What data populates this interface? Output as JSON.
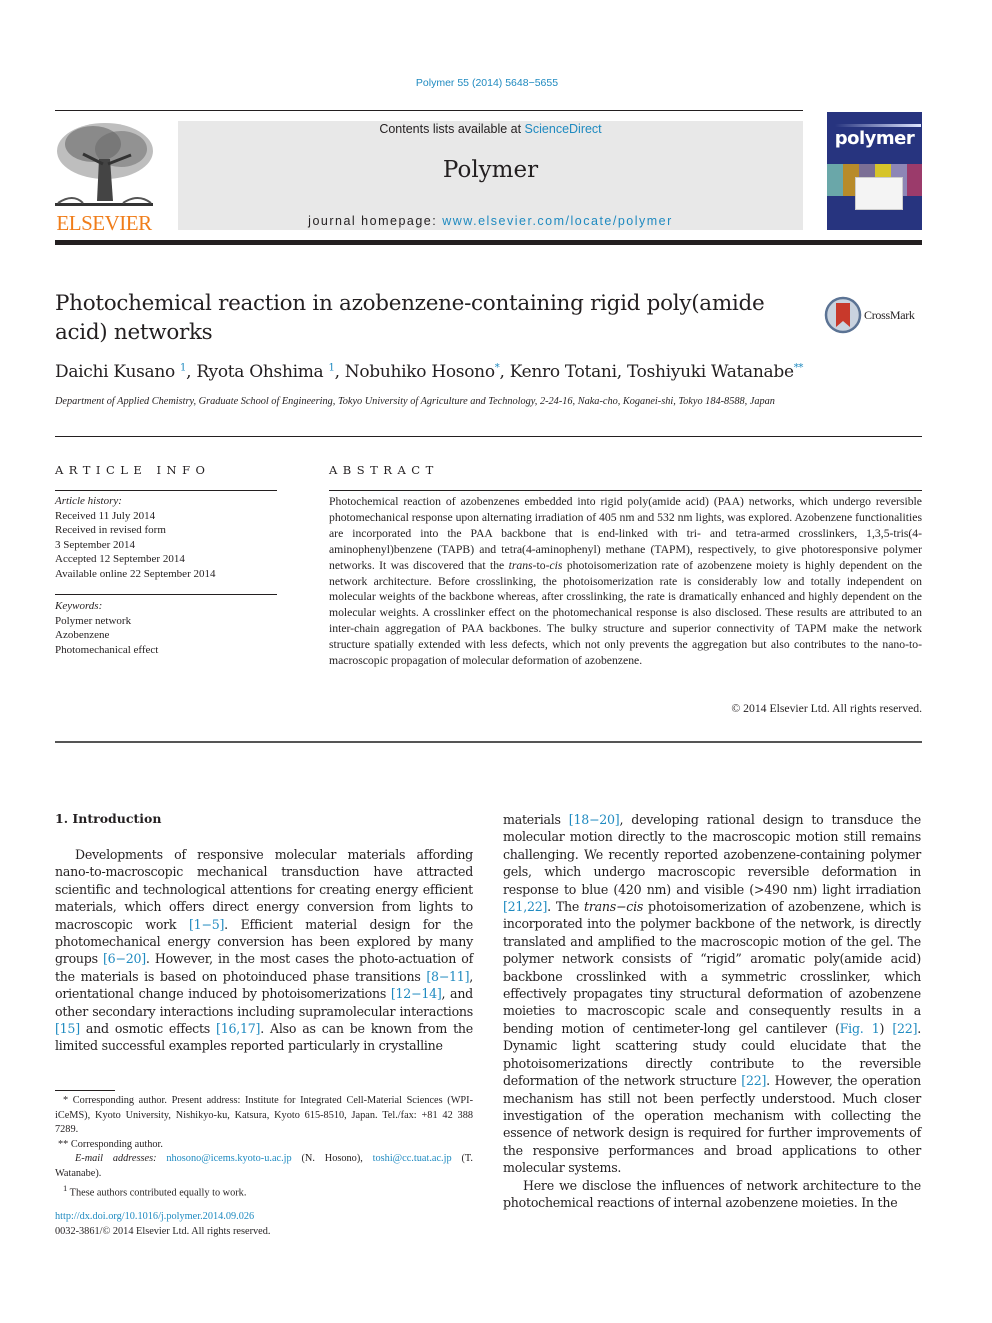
{
  "header": {
    "citation": "Polymer 55 (2014) 5648−5655",
    "contents_prefix": "Contents lists available at ",
    "contents_link": "ScienceDirect",
    "journal_title": "Polymer",
    "homepage_prefix": "journal homepage: ",
    "homepage_link": "www.elsevier.com/locate/polymer",
    "publisher_logo_text": "ELSEVIER",
    "cover_title": "polymer"
  },
  "article": {
    "title": "Photochemical reaction in azobenzene-containing rigid poly(amide acid) networks",
    "crossmark_label": "CrossMark",
    "authors": [
      {
        "name": "Daichi Kusano",
        "mark": "1",
        "sep": ", "
      },
      {
        "name": "Ryota Ohshima",
        "mark": "1",
        "sep": ", "
      },
      {
        "name": "Nobuhiko Hosono",
        "mark": "*",
        "sep": ", "
      },
      {
        "name": "Kenro Totani",
        "mark": "",
        "sep": ", "
      },
      {
        "name": "Toshiyuki Watanabe",
        "mark": "**",
        "sep": ""
      }
    ],
    "affiliation": "Department of Applied Chemistry, Graduate School of Engineering, Tokyo University of Agriculture and Technology, 2-24-16, Naka-cho, Koganei-shi, Tokyo 184-8588, Japan"
  },
  "article_info": {
    "heading": "ARTICLE INFO",
    "history_label": "Article history:",
    "history": [
      "Received 11 July 2014",
      "Received in revised form",
      "3 September 2014",
      "Accepted 12 September 2014",
      "Available online 22 September 2014"
    ],
    "keywords_label": "Keywords:",
    "keywords": [
      "Polymer network",
      "Azobenzene",
      "Photomechanical effect"
    ]
  },
  "abstract": {
    "heading": "ABSTRACT",
    "part1": "Photochemical reaction of azobenzenes embedded into rigid poly(amide acid) (PAA) networks, which undergo reversible photomechanical response upon alternating irradiation of 405 nm and 532 nm lights, was explored. Azobenzene functionalities are incorporated into the PAA backbone that is end-linked with tri- and tetra-armed crosslinkers, 1,3,5-tris(4-aminophenyl)benzene (TAPB) and tetra(4-aminophenyl) methane (TAPM), respectively, to give photoresponsive polymer networks. It was discovered that the ",
    "italic1": "trans",
    "part2": "-to-",
    "italic2": "cis",
    "part3": " photoisomerization rate of azobenzene moiety is highly dependent on the network architecture. Before crosslinking, the photoisomerization rate is considerably low and totally independent on molecular weights of the backbone whereas, after crosslinking, the rate is dramatically enhanced and highly dependent on the molecular weights. A crosslinker effect on the photomechanical response is also disclosed. These results are attributed to an inter-chain aggregation of PAA backbones. The bulky structure and superior connectivity of TAPM make the network structure spatially extended with less defects, which not only prevents the aggregation but also contributes to the nano-to-macroscopic propagation of molecular deformation of azobenzene.",
    "copyright": "© 2014 Elsevier Ltd. All rights reserved."
  },
  "intro": {
    "heading": "1.  Introduction",
    "left": [
      {
        "t": "Developments of responsive molecular materials affording nano-to-macroscopic mechanical transduction have attracted scientific and technological attentions for creating energy efficient materials, which offers direct energy conversion from lights to macroscopic work "
      },
      {
        "ref": "[1−5]"
      },
      {
        "t": ". Efficient material design for the photomechanical energy conversion has been explored by many groups "
      },
      {
        "ref": "[6−20]"
      },
      {
        "t": ". However, in the most cases the photo-actuation of the materials is based on photoinduced phase transitions "
      },
      {
        "ref": "[8−11]"
      },
      {
        "t": ", orientational change induced by photoisomerizations "
      },
      {
        "ref": "[12−14]"
      },
      {
        "t": ", and other secondary interactions including supramolecular interactions "
      },
      {
        "ref": "[15]"
      },
      {
        "t": " and osmotic effects "
      },
      {
        "ref": "[16,17]"
      },
      {
        "t": ". Also as can be known from the limited successful examples reported particularly in crystalline"
      }
    ],
    "right_p1": [
      {
        "t": "materials "
      },
      {
        "ref": "[18−20]"
      },
      {
        "t": ", developing rational design to transduce the molecular motion directly to the macroscopic motion still remains challenging. We recently reported azobenzene-containing polymer gels, which undergo macroscopic reversible deformation in response to blue (420 nm) and visible (>490 nm) light irradiation "
      },
      {
        "ref": "[21,22]"
      },
      {
        "t": ". The "
      },
      {
        "i": "trans"
      },
      {
        "t": "−"
      },
      {
        "i": "cis"
      },
      {
        "t": " photoisomerization of azobenzene, which is incorporated into the polymer backbone of the network, is directly translated and amplified to the macroscopic motion of the gel. The polymer network consists of “rigid” aromatic poly(amide acid) backbone crosslinked with a symmetric crosslinker, which effectively propagates tiny structural deformation of azobenzene moieties to macroscopic scale and consequently results in a bending motion of centimeter-long gel cantilever ("
      },
      {
        "ref": "Fig. 1"
      },
      {
        "t": ") "
      },
      {
        "ref": "[22]"
      },
      {
        "t": ". Dynamic light scattering study could elucidate that the photoisomerizations directly contribute to the reversible deformation of the network structure "
      },
      {
        "ref": "[22]"
      },
      {
        "t": ". However, the operation mechanism has still not been perfectly understood. Much closer investigation of the operation mechanism with collecting the essence of network design is required for further improvements of the responsive performances and broad applications to other molecular systems."
      }
    ],
    "right_p2": "Here we disclose the influences of network architecture to the photochemical reactions of internal azobenzene moieties. In the"
  },
  "footnotes": {
    "fn1": "* Corresponding author. Present address: Institute for Integrated Cell-Material Sciences (WPI-iCeMS), Kyoto University, Nishikyo-ku, Katsura, Kyoto 615-8510, Japan. Tel./fax: +81 42 388 7289.",
    "fn2": "** Corresponding author.",
    "email_label": "E-mail addresses: ",
    "email1": "nhosono@icems.kyoto-u.ac.jp",
    "email1_owner": " (N. Hosono), ",
    "email2": "toshi@cc.tuat.ac.jp",
    "email2_owner": " (T. Watanabe).",
    "fn3_mark": "1",
    "fn3": " These authors contributed equally to work.",
    "doi": "http://dx.doi.org/10.1016/j.polymer.2014.09.026",
    "issn": "0032-3861/© 2014 Elsevier Ltd. All rights reserved."
  },
  "colors": {
    "link": "#1f8ac0",
    "elsevier_orange": "#f07d1a",
    "cover_blue": "#27347f",
    "header_box": "#e8e8e8"
  }
}
